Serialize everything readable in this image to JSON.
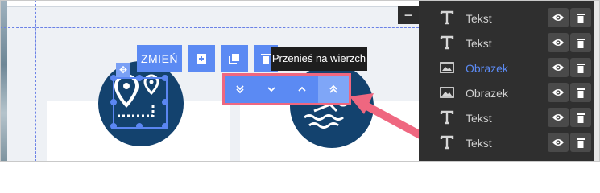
{
  "toolbar": {
    "change_label": "ZMIEŃ",
    "tooltip": "Przenieś na wierzch"
  },
  "z_order": [
    {
      "name": "send-to-back",
      "icon": "double-chevron-down"
    },
    {
      "name": "send-backward",
      "icon": "chevron-down"
    },
    {
      "name": "bring-forward",
      "icon": "chevron-up"
    },
    {
      "name": "bring-to-front",
      "icon": "double-chevron-up"
    }
  ],
  "layers": [
    {
      "label": "Tekst",
      "type": "text",
      "active": false
    },
    {
      "label": "Tekst",
      "type": "text",
      "active": false
    },
    {
      "label": "Obrazek",
      "type": "image",
      "active": true
    },
    {
      "label": "Obrazek",
      "type": "image",
      "active": false
    },
    {
      "label": "Tekst",
      "type": "text",
      "active": false
    },
    {
      "label": "Tekst",
      "type": "text",
      "active": false
    }
  ],
  "colors": {
    "accent": "#5b8af3",
    "annotation": "#ef6780",
    "circle": "#13426e",
    "panel": "#2f2f2f"
  }
}
